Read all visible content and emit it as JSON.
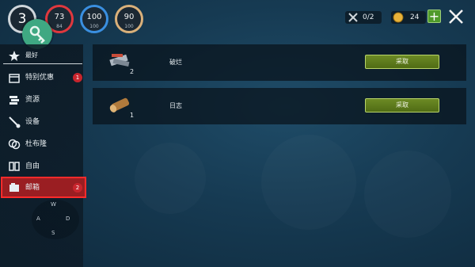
{
  "hud": {
    "level": "3",
    "stats": [
      {
        "value": "73",
        "max": "84",
        "color": "#e0383e"
      },
      {
        "value": "100",
        "max": "100",
        "color": "#3a8fe0"
      },
      {
        "value": "90",
        "max": "100",
        "color": "#d9b07a"
      }
    ],
    "tools_count": "0/2",
    "coins": "24"
  },
  "sidebar": {
    "items": [
      {
        "label": "最好",
        "icon": "star-icon"
      },
      {
        "label": "特别优惠",
        "icon": "box-icon",
        "badge": "1"
      },
      {
        "label": "资源",
        "icon": "resources-icon"
      },
      {
        "label": "设备",
        "icon": "equipment-icon"
      },
      {
        "label": "杜布隆",
        "icon": "coins-icon"
      },
      {
        "label": "自由",
        "icon": "freedom-icon"
      },
      {
        "label": "邮箱",
        "icon": "mailbox-icon",
        "badge": "2"
      }
    ]
  },
  "dpad": {
    "w": "W",
    "a": "A",
    "d": "D",
    "s": "S"
  },
  "rows": [
    {
      "name": "破烂",
      "count": "2",
      "button": "采取",
      "icon": "scrap-icon"
    },
    {
      "name": "日志",
      "count": "1",
      "button": "采取",
      "icon": "log-icon"
    }
  ],
  "colors": {
    "accent_green": "#506c14",
    "badge_red": "#c8252d",
    "highlight_red": "#ff2b2b"
  }
}
